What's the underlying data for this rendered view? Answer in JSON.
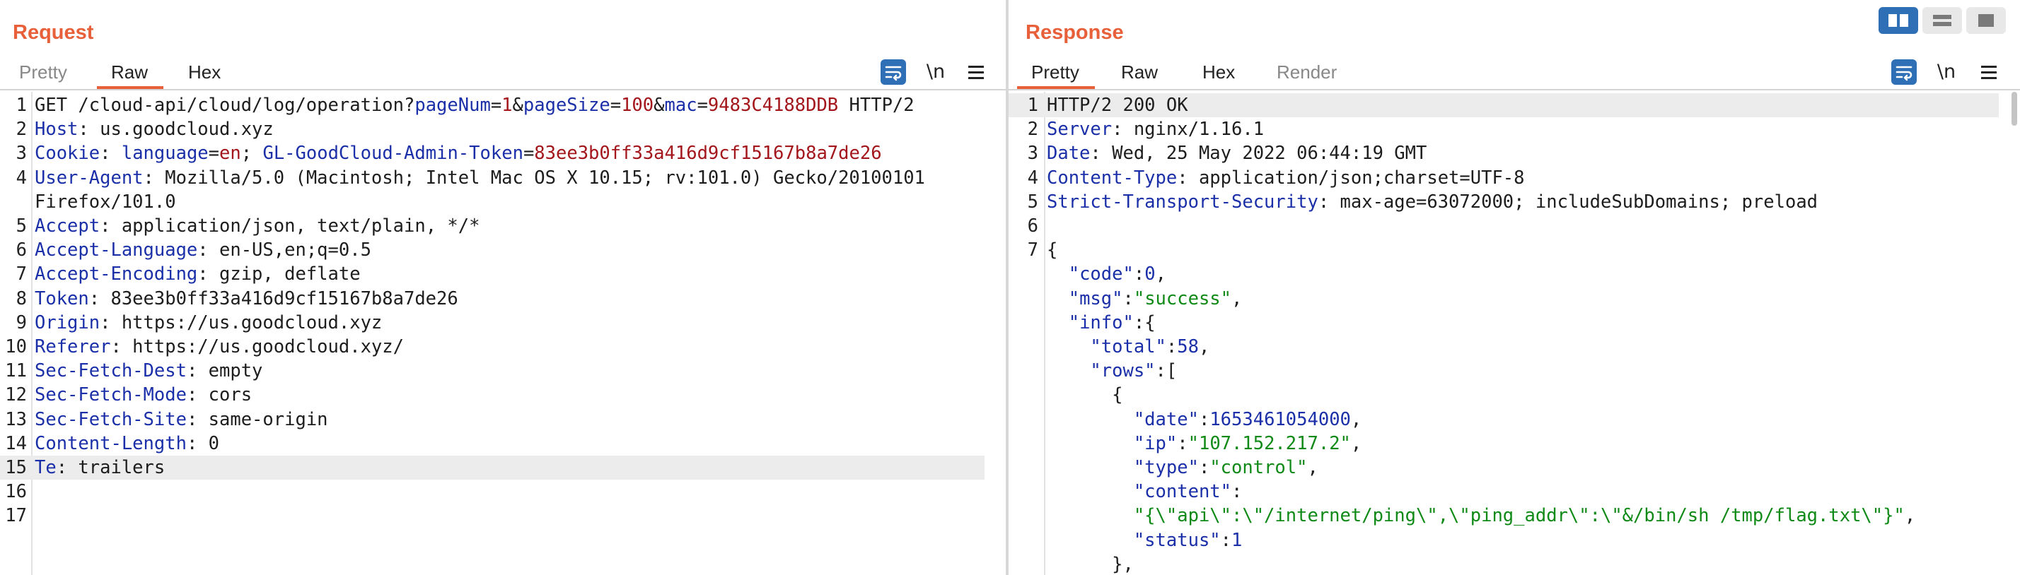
{
  "request": {
    "title": "Request",
    "tabs": [
      "Pretty",
      "Raw",
      "Hex"
    ],
    "active_tab": "Raw",
    "toolbar": {
      "wrap_icon": "wrap-lines-icon",
      "newline_label": "\\n",
      "menu_icon": "hamburger-menu-icon"
    },
    "highlighted_line": 15,
    "lines": [
      {
        "n": "1",
        "parts": [
          [
            "t",
            "GET /cloud-api/cloud/log/operation?"
          ],
          [
            "k",
            "pageNum"
          ],
          [
            "t",
            "="
          ],
          [
            "v",
            "1"
          ],
          [
            "t",
            "&"
          ],
          [
            "k",
            "pageSize"
          ],
          [
            "t",
            "="
          ],
          [
            "v",
            "100"
          ],
          [
            "t",
            "&"
          ],
          [
            "k",
            "mac"
          ],
          [
            "t",
            "="
          ],
          [
            "v",
            "9483C4188DDB"
          ],
          [
            "t",
            " HTTP/2"
          ]
        ]
      },
      {
        "n": "2",
        "parts": [
          [
            "k",
            "Host"
          ],
          [
            "t",
            ": us.goodcloud.xyz"
          ]
        ]
      },
      {
        "n": "3",
        "parts": [
          [
            "k",
            "Cookie"
          ],
          [
            "t",
            ": "
          ],
          [
            "k",
            "language"
          ],
          [
            "t",
            "="
          ],
          [
            "v",
            "en"
          ],
          [
            "t",
            "; "
          ],
          [
            "k",
            "GL-GoodCloud-Admin-Token"
          ],
          [
            "t",
            "="
          ],
          [
            "v",
            "83ee3b0ff33a416d9cf15167b8a7de26"
          ]
        ]
      },
      {
        "n": "4",
        "parts": [
          [
            "k",
            "User-Agent"
          ],
          [
            "t",
            ": Mozilla/5.0 (Macintosh; Intel Mac OS X 10.15; rv:101.0) Gecko/20100101"
          ]
        ]
      },
      {
        "n": "",
        "parts": [
          [
            "t",
            "Firefox/101.0"
          ]
        ]
      },
      {
        "n": "5",
        "parts": [
          [
            "k",
            "Accept"
          ],
          [
            "t",
            ": application/json, text/plain, */*"
          ]
        ]
      },
      {
        "n": "6",
        "parts": [
          [
            "k",
            "Accept-Language"
          ],
          [
            "t",
            ": en-US,en;q=0.5"
          ]
        ]
      },
      {
        "n": "7",
        "parts": [
          [
            "k",
            "Accept-Encoding"
          ],
          [
            "t",
            ": gzip, deflate"
          ]
        ]
      },
      {
        "n": "8",
        "parts": [
          [
            "k",
            "Token"
          ],
          [
            "t",
            ": 83ee3b0ff33a416d9cf15167b8a7de26"
          ]
        ]
      },
      {
        "n": "9",
        "parts": [
          [
            "k",
            "Origin"
          ],
          [
            "t",
            ": https://us.goodcloud.xyz"
          ]
        ]
      },
      {
        "n": "10",
        "parts": [
          [
            "k",
            "Referer"
          ],
          [
            "t",
            ": https://us.goodcloud.xyz/"
          ]
        ]
      },
      {
        "n": "11",
        "parts": [
          [
            "k",
            "Sec-Fetch-Dest"
          ],
          [
            "t",
            ": empty"
          ]
        ]
      },
      {
        "n": "12",
        "parts": [
          [
            "k",
            "Sec-Fetch-Mode"
          ],
          [
            "t",
            ": cors"
          ]
        ]
      },
      {
        "n": "13",
        "parts": [
          [
            "k",
            "Sec-Fetch-Site"
          ],
          [
            "t",
            ": same-origin"
          ]
        ]
      },
      {
        "n": "14",
        "parts": [
          [
            "k",
            "Content-Length"
          ],
          [
            "t",
            ": 0"
          ]
        ]
      },
      {
        "n": "15",
        "parts": [
          [
            "k",
            "Te"
          ],
          [
            "t",
            ": trailers"
          ]
        ]
      },
      {
        "n": "16",
        "parts": []
      },
      {
        "n": "17",
        "parts": []
      }
    ]
  },
  "response": {
    "title": "Response",
    "tabs": [
      "Pretty",
      "Raw",
      "Hex",
      "Render"
    ],
    "active_tab": "Pretty",
    "muted_tab": "Render",
    "toolbar": {
      "wrap_icon": "wrap-lines-icon",
      "newline_label": "\\n",
      "menu_icon": "hamburger-menu-icon"
    },
    "highlighted_line": 1,
    "lines": [
      {
        "n": "1",
        "parts": [
          [
            "t",
            "HTTP/2 200 OK"
          ]
        ]
      },
      {
        "n": "2",
        "parts": [
          [
            "k",
            "Server"
          ],
          [
            "t",
            ": nginx/1.16.1"
          ]
        ]
      },
      {
        "n": "3",
        "parts": [
          [
            "k",
            "Date"
          ],
          [
            "t",
            ": Wed, 25 May 2022 06:44:19 GMT"
          ]
        ]
      },
      {
        "n": "4",
        "parts": [
          [
            "k",
            "Content-Type"
          ],
          [
            "t",
            ": application/json;charset=UTF-8"
          ]
        ]
      },
      {
        "n": "5",
        "parts": [
          [
            "k",
            "Strict-Transport-Security"
          ],
          [
            "t",
            ": max-age=63072000; includeSubDomains; preload"
          ]
        ]
      },
      {
        "n": "6",
        "parts": []
      },
      {
        "n": "7",
        "parts": [
          [
            "t",
            "{"
          ]
        ]
      },
      {
        "n": "",
        "parts": [
          [
            "t",
            "  "
          ],
          [
            "k",
            "\"code\""
          ],
          [
            "t",
            ":"
          ],
          [
            "num",
            "0"
          ],
          [
            "t",
            ","
          ]
        ]
      },
      {
        "n": "",
        "parts": [
          [
            "t",
            "  "
          ],
          [
            "k",
            "\"msg\""
          ],
          [
            "t",
            ":"
          ],
          [
            "str",
            "\"success\""
          ],
          [
            "t",
            ","
          ]
        ]
      },
      {
        "n": "",
        "parts": [
          [
            "t",
            "  "
          ],
          [
            "k",
            "\"info\""
          ],
          [
            "t",
            ":{"
          ]
        ]
      },
      {
        "n": "",
        "parts": [
          [
            "t",
            "    "
          ],
          [
            "k",
            "\"total\""
          ],
          [
            "t",
            ":"
          ],
          [
            "num",
            "58"
          ],
          [
            "t",
            ","
          ]
        ]
      },
      {
        "n": "",
        "parts": [
          [
            "t",
            "    "
          ],
          [
            "k",
            "\"rows\""
          ],
          [
            "t",
            ":["
          ]
        ]
      },
      {
        "n": "",
        "parts": [
          [
            "t",
            "      {"
          ]
        ]
      },
      {
        "n": "",
        "parts": [
          [
            "t",
            "        "
          ],
          [
            "k",
            "\"date\""
          ],
          [
            "t",
            ":"
          ],
          [
            "num",
            "1653461054000"
          ],
          [
            "t",
            ","
          ]
        ]
      },
      {
        "n": "",
        "parts": [
          [
            "t",
            "        "
          ],
          [
            "k",
            "\"ip\""
          ],
          [
            "t",
            ":"
          ],
          [
            "str",
            "\"107.152.217.2\""
          ],
          [
            "t",
            ","
          ]
        ]
      },
      {
        "n": "",
        "parts": [
          [
            "t",
            "        "
          ],
          [
            "k",
            "\"type\""
          ],
          [
            "t",
            ":"
          ],
          [
            "str",
            "\"control\""
          ],
          [
            "t",
            ","
          ]
        ]
      },
      {
        "n": "",
        "parts": [
          [
            "t",
            "        "
          ],
          [
            "k",
            "\"content\""
          ],
          [
            "t",
            ":"
          ]
        ]
      },
      {
        "n": "",
        "parts": [
          [
            "t",
            "        "
          ],
          [
            "str",
            "\"{\\\"api\\\":\\\"/internet/ping\\\",\\\"ping_addr\\\":\\\"&/bin/sh /tmp/flag.txt\\\"}\""
          ],
          [
            "t",
            ","
          ]
        ]
      },
      {
        "n": "",
        "parts": [
          [
            "t",
            "        "
          ],
          [
            "k",
            "\"status\""
          ],
          [
            "t",
            ":"
          ],
          [
            "num",
            "1"
          ]
        ]
      },
      {
        "n": "",
        "parts": [
          [
            "t",
            "      },"
          ]
        ]
      }
    ]
  },
  "layout_toggle": {
    "buttons": [
      "layout-side-by-side-icon",
      "layout-stacked-icon",
      "layout-single-icon"
    ],
    "active": "layout-side-by-side-icon"
  }
}
